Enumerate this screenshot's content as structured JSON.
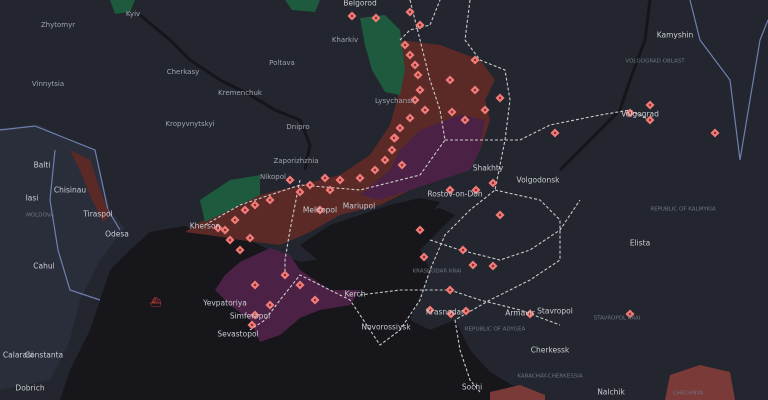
{
  "map": {
    "colors": {
      "land": "#23262e",
      "sea": "#16161b",
      "occupied": "#5b2a27",
      "crimea_donbas": "#4b2245",
      "liberated": "#1e5a3d",
      "marker": "#f07b78",
      "road": "#e8e8e8",
      "border": "#6f7fb0"
    },
    "cities": [
      "Zhytomyr",
      "Kyiv",
      "Kharkiv",
      "Poltava",
      "Cherkasy",
      "Kremenchuk",
      "Vinnytsia",
      "Kropyvnytskyi",
      "Dnipro",
      "Zaporizhzhia",
      "Nikopol",
      "Lysychansk",
      "Kamyshin",
      "Volgograd",
      "Shakhty",
      "Volgodonsk",
      "Rostov-on-Don",
      "Melitopol",
      "Mariupol",
      "Kherson",
      "Odesa",
      "Tiraspol",
      "Chisinau",
      "Balti",
      "Iasi",
      "Cahul",
      "Yevpatoriya",
      "Simferopol",
      "Sevastopol",
      "Kerch",
      "Novorossiysk",
      "Krasnodar",
      "Armavir",
      "Stavropol",
      "Elista",
      "Cherkessk",
      "Nalchik",
      "Sochi",
      "Constanta",
      "Calarasi",
      "Dobrich",
      "Belgorod"
    ],
    "regions": [
      "VOLGOGRAD OBLAST",
      "REPUBLIC OF KALMYKIA",
      "KRASNODAR KRAI",
      "REPUBLIC OF ADYGEA",
      "STAVROPOL KRAI",
      "KARACHAY-CHERKESSIA",
      "CHECHNYA",
      "MOLDOVA"
    ]
  }
}
